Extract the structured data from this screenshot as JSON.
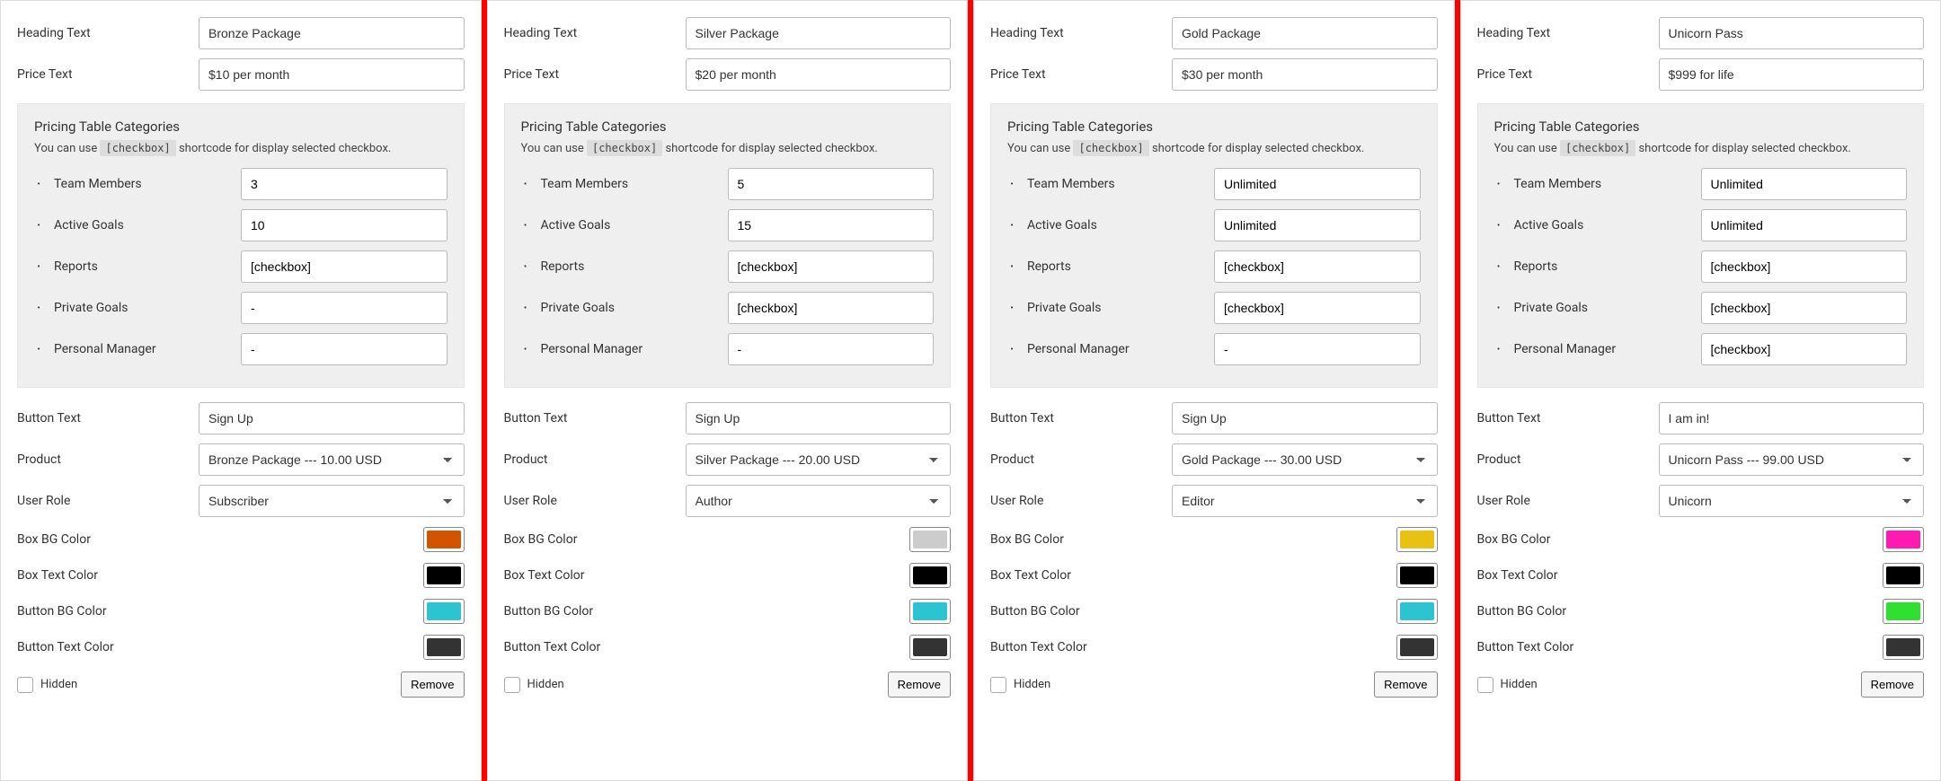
{
  "labels": {
    "heading": "Heading Text",
    "price": "Price Text",
    "categories_title": "Pricing Table Categories",
    "categories_sub_prefix": "You can use ",
    "categories_sub_code": "[checkbox]",
    "categories_sub_suffix": " shortcode for display selected checkbox.",
    "button_text": "Button Text",
    "product": "Product",
    "user_role": "User Role",
    "box_bg": "Box BG Color",
    "box_text": "Box Text Color",
    "btn_bg": "Button BG Color",
    "btn_text": "Button Text Color",
    "hidden": "Hidden",
    "remove": "Remove",
    "cat_names": {
      "team_members": "Team Members",
      "active_goals": "Active Goals",
      "reports": "Reports",
      "private_goals": "Private Goals",
      "personal_manager": "Personal Manager"
    }
  },
  "columns": [
    {
      "heading_value": "Bronze Package",
      "price_value": "$10 per month",
      "cats": {
        "team_members": "3",
        "active_goals": "10",
        "reports": "[checkbox]",
        "private_goals": "-",
        "personal_manager": "-"
      },
      "button_value": "Sign Up",
      "product_value": "Bronze Package --- 10.00 USD",
      "role_value": "Subscriber",
      "colors": {
        "box_bg": "#d35400",
        "box_text": "#000000",
        "btn_bg": "#2cc4d3",
        "btn_text": "#333333"
      }
    },
    {
      "heading_value": "Silver Package",
      "price_value": "$20 per month",
      "cats": {
        "team_members": "5",
        "active_goals": "15",
        "reports": "[checkbox]",
        "private_goals": "[checkbox]",
        "personal_manager": "-"
      },
      "button_value": "Sign Up",
      "product_value": "Silver Package --- 20.00 USD",
      "role_value": "Author",
      "colors": {
        "box_bg": "#cccccc",
        "box_text": "#000000",
        "btn_bg": "#2cc4d3",
        "btn_text": "#333333"
      }
    },
    {
      "heading_value": "Gold Package",
      "price_value": "$30 per month",
      "cats": {
        "team_members": "Unlimited",
        "active_goals": "Unlimited",
        "reports": "[checkbox]",
        "private_goals": "[checkbox]",
        "personal_manager": "-"
      },
      "button_value": "Sign Up",
      "product_value": "Gold Package --- 30.00 USD",
      "role_value": "Editor",
      "colors": {
        "box_bg": "#e8c112",
        "box_text": "#000000",
        "btn_bg": "#2cc4d3",
        "btn_text": "#333333"
      }
    },
    {
      "heading_value": "Unicorn Pass",
      "price_value": "$999 for life",
      "cats": {
        "team_members": "Unlimited",
        "active_goals": "Unlimited",
        "reports": "[checkbox]",
        "private_goals": "[checkbox]",
        "personal_manager": "[checkbox]"
      },
      "button_value": "I am in!",
      "product_value": "Unicorn Pass --- 99.00 USD",
      "role_value": "Unicorn",
      "colors": {
        "box_bg": "#ff1ab3",
        "box_text": "#000000",
        "btn_bg": "#30e030",
        "btn_text": "#333333"
      }
    }
  ]
}
